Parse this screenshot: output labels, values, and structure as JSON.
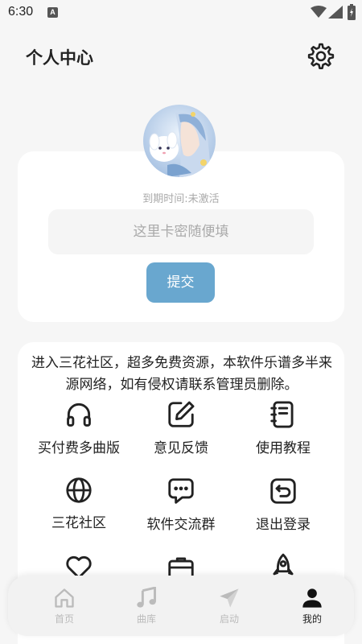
{
  "status": {
    "time": "6:30",
    "notif_letter": "A"
  },
  "header": {
    "title": "个人中心"
  },
  "profile": {
    "expire_text": "到期时间:未激活",
    "card_placeholder": "这里卡密随便填",
    "submit_label": "提交"
  },
  "notice": "进入三花社区，超多免费资源，本软件乐谱多半来源网络，如有侵权请联系管理员删除。",
  "menu": [
    {
      "label": "买付费多曲版",
      "icon": "headphones-icon"
    },
    {
      "label": "意见反馈",
      "icon": "edit-icon"
    },
    {
      "label": "使用教程",
      "icon": "notebook-icon"
    },
    {
      "label": "三花社区",
      "icon": "globe-icon"
    },
    {
      "label": "软件交流群",
      "icon": "chat-icon"
    },
    {
      "label": "退出登录",
      "icon": "logout-icon"
    },
    {
      "label": "",
      "icon": "heart-icon"
    },
    {
      "label": "",
      "icon": "briefcase-icon"
    },
    {
      "label": "",
      "icon": "rocket-icon"
    }
  ],
  "nav": [
    {
      "label": "首页",
      "icon": "home-icon",
      "active": false
    },
    {
      "label": "曲库",
      "icon": "music-icon",
      "active": false
    },
    {
      "label": "启动",
      "icon": "send-icon",
      "active": false
    },
    {
      "label": "我的",
      "icon": "user-icon",
      "active": true
    }
  ],
  "colors": {
    "accent": "#69a7cf",
    "background": "#f6f6f6",
    "card": "#ffffff",
    "muted": "#aaaaaa"
  }
}
